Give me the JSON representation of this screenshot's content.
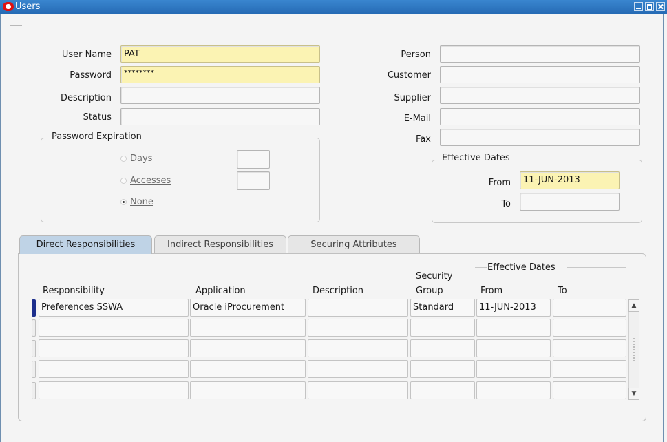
{
  "window": {
    "title": "Users",
    "logo_icon": "oracle-logo-icon"
  },
  "user_form": {
    "user_name_label": "User Name",
    "user_name_value": "PAT",
    "password_label": "Password",
    "password_value": "********",
    "description_label": "Description",
    "description_value": "",
    "status_label": "Status",
    "status_value": ""
  },
  "password_expiration": {
    "title": "Password Expiration",
    "options": [
      {
        "label": "Days",
        "selected": false
      },
      {
        "label": "Accesses",
        "selected": false
      },
      {
        "label": "None",
        "selected": true
      }
    ],
    "days_value": "",
    "accesses_value": ""
  },
  "party_form": {
    "person_label": "Person",
    "person_value": "",
    "customer_label": "Customer",
    "customer_value": "",
    "supplier_label": "Supplier",
    "supplier_value": "",
    "email_label": "E-Mail",
    "email_value": "",
    "fax_label": "Fax",
    "fax_value": ""
  },
  "effective_dates": {
    "title": "Effective Dates",
    "from_label": "From",
    "from_value": "11-JUN-2013",
    "to_label": "To",
    "to_value": ""
  },
  "tabs": [
    {
      "label": "Direct Responsibilities",
      "active": true
    },
    {
      "label": "Indirect Responsibilities",
      "active": false
    },
    {
      "label": "Securing Attributes",
      "active": false
    }
  ],
  "grid": {
    "effective_dates_header": "Effective Dates",
    "columns": {
      "responsibility": "Responsibility",
      "application": "Application",
      "description": "Description",
      "security_group_line1": "Security",
      "security_group_line2": "Group",
      "from": "From",
      "to": "To"
    },
    "rows": [
      {
        "responsibility": "Preferences SSWA",
        "application": "Oracle iProcurement",
        "description": "",
        "security_group": "Standard",
        "from": "11-JUN-2013",
        "to": ""
      },
      {
        "responsibility": "",
        "application": "",
        "description": "",
        "security_group": "",
        "from": "",
        "to": ""
      },
      {
        "responsibility": "",
        "application": "",
        "description": "",
        "security_group": "",
        "from": "",
        "to": ""
      },
      {
        "responsibility": "",
        "application": "",
        "description": "",
        "security_group": "",
        "from": "",
        "to": ""
      },
      {
        "responsibility": "",
        "application": "",
        "description": "",
        "security_group": "",
        "from": "",
        "to": ""
      }
    ]
  },
  "colors": {
    "title_bar": "#2a73bf",
    "required_field": "#fbf3b3",
    "active_tab": "#bfd3e6",
    "current_record": "#1c2e8c"
  }
}
